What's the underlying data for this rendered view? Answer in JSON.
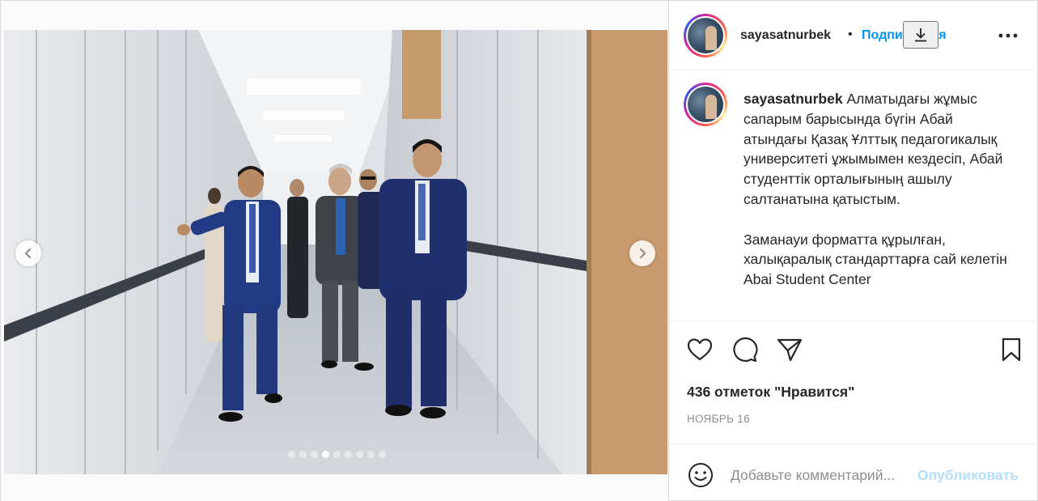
{
  "post": {
    "username": "sayasatnurbek",
    "separator": "•",
    "follow_label": "Подписаться",
    "caption": "Алматыдағы жұмыс сапарым барысында бүгін Абай атындағы Қазақ Ұлттық педагогикалық университеті ұжымымен кездесіп, Абай студенттік орталығының ашылу салтанатына қатыстым.\n\nЗаманауи форматта құрылған, халықаралық стандарттарға сай келетін Abai Student Center",
    "likes_text": "436 отметок \"Нравится\"",
    "date_text": "НОЯБРЬ 16",
    "comment_placeholder": "Добавьте комментарий...",
    "publish_label": "Опубликовать"
  },
  "carousel": {
    "total_slides": 9,
    "active_index": 3
  },
  "icons": {
    "prev": "chevron-left-icon",
    "next": "chevron-right-icon",
    "download": "download-icon",
    "more": "more-horizontal-icon",
    "like": "heart-icon",
    "comment": "comment-icon",
    "share": "share-icon",
    "save": "bookmark-icon",
    "emoji": "emoji-icon"
  },
  "colors": {
    "accent": "#0095f6",
    "publish_disabled": "#b2dffc",
    "muted": "#8e8e8e"
  }
}
